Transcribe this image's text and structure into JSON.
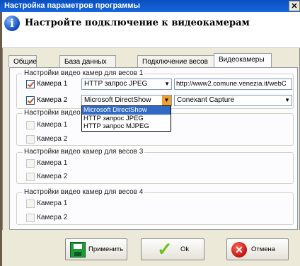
{
  "window": {
    "title": "Настройка параметров программы",
    "close_glyph": "✕"
  },
  "header": {
    "title": "Настройте подключение к видеокамерам",
    "icon": "info-icon",
    "icon_glyph": "i"
  },
  "tabs": [
    {
      "label": "Общие",
      "active": false
    },
    {
      "label": "База данных",
      "active": false
    },
    {
      "label": "Подключение весов",
      "active": false
    },
    {
      "label": "Видеокамеры",
      "active": true
    }
  ],
  "groups": [
    {
      "title": "Настройки видео камер для весов 1",
      "cameras": [
        {
          "label": "Камера 1",
          "checked": true,
          "source": "HTTP запрос JPEG",
          "param": "http://www2.comune.venezia.it/webC"
        },
        {
          "label": "Камера 2",
          "checked": true,
          "source": "Microsoft DirectShow",
          "param": "Conexant Capture"
        }
      ]
    },
    {
      "title": "Настройки видео",
      "cameras": [
        {
          "label": "Камера 1",
          "checked": false
        },
        {
          "label": "Камера 2",
          "checked": false
        }
      ]
    },
    {
      "title": "Настройки видео камер для весов 3",
      "cameras": [
        {
          "label": "Камера 1",
          "checked": false
        },
        {
          "label": "Камера 2",
          "checked": false
        }
      ]
    },
    {
      "title": "Настройки видео камер для весов 4",
      "cameras": [
        {
          "label": "Камера 1",
          "checked": false
        },
        {
          "label": "Камера 2",
          "checked": false
        }
      ]
    }
  ],
  "dropdown_options": [
    "Microsoft DirectShow",
    "HTTP запрос JPEG",
    "HTTP запрос MJPEG"
  ],
  "dropdown_selected": "Microsoft DirectShow",
  "buttons": {
    "apply": "Применить",
    "ok": "Ok",
    "cancel": "Отмена"
  },
  "colors": {
    "titlebar": "#0a4fc0",
    "selection": "#316ac5",
    "accent_check": "#c8581a"
  }
}
